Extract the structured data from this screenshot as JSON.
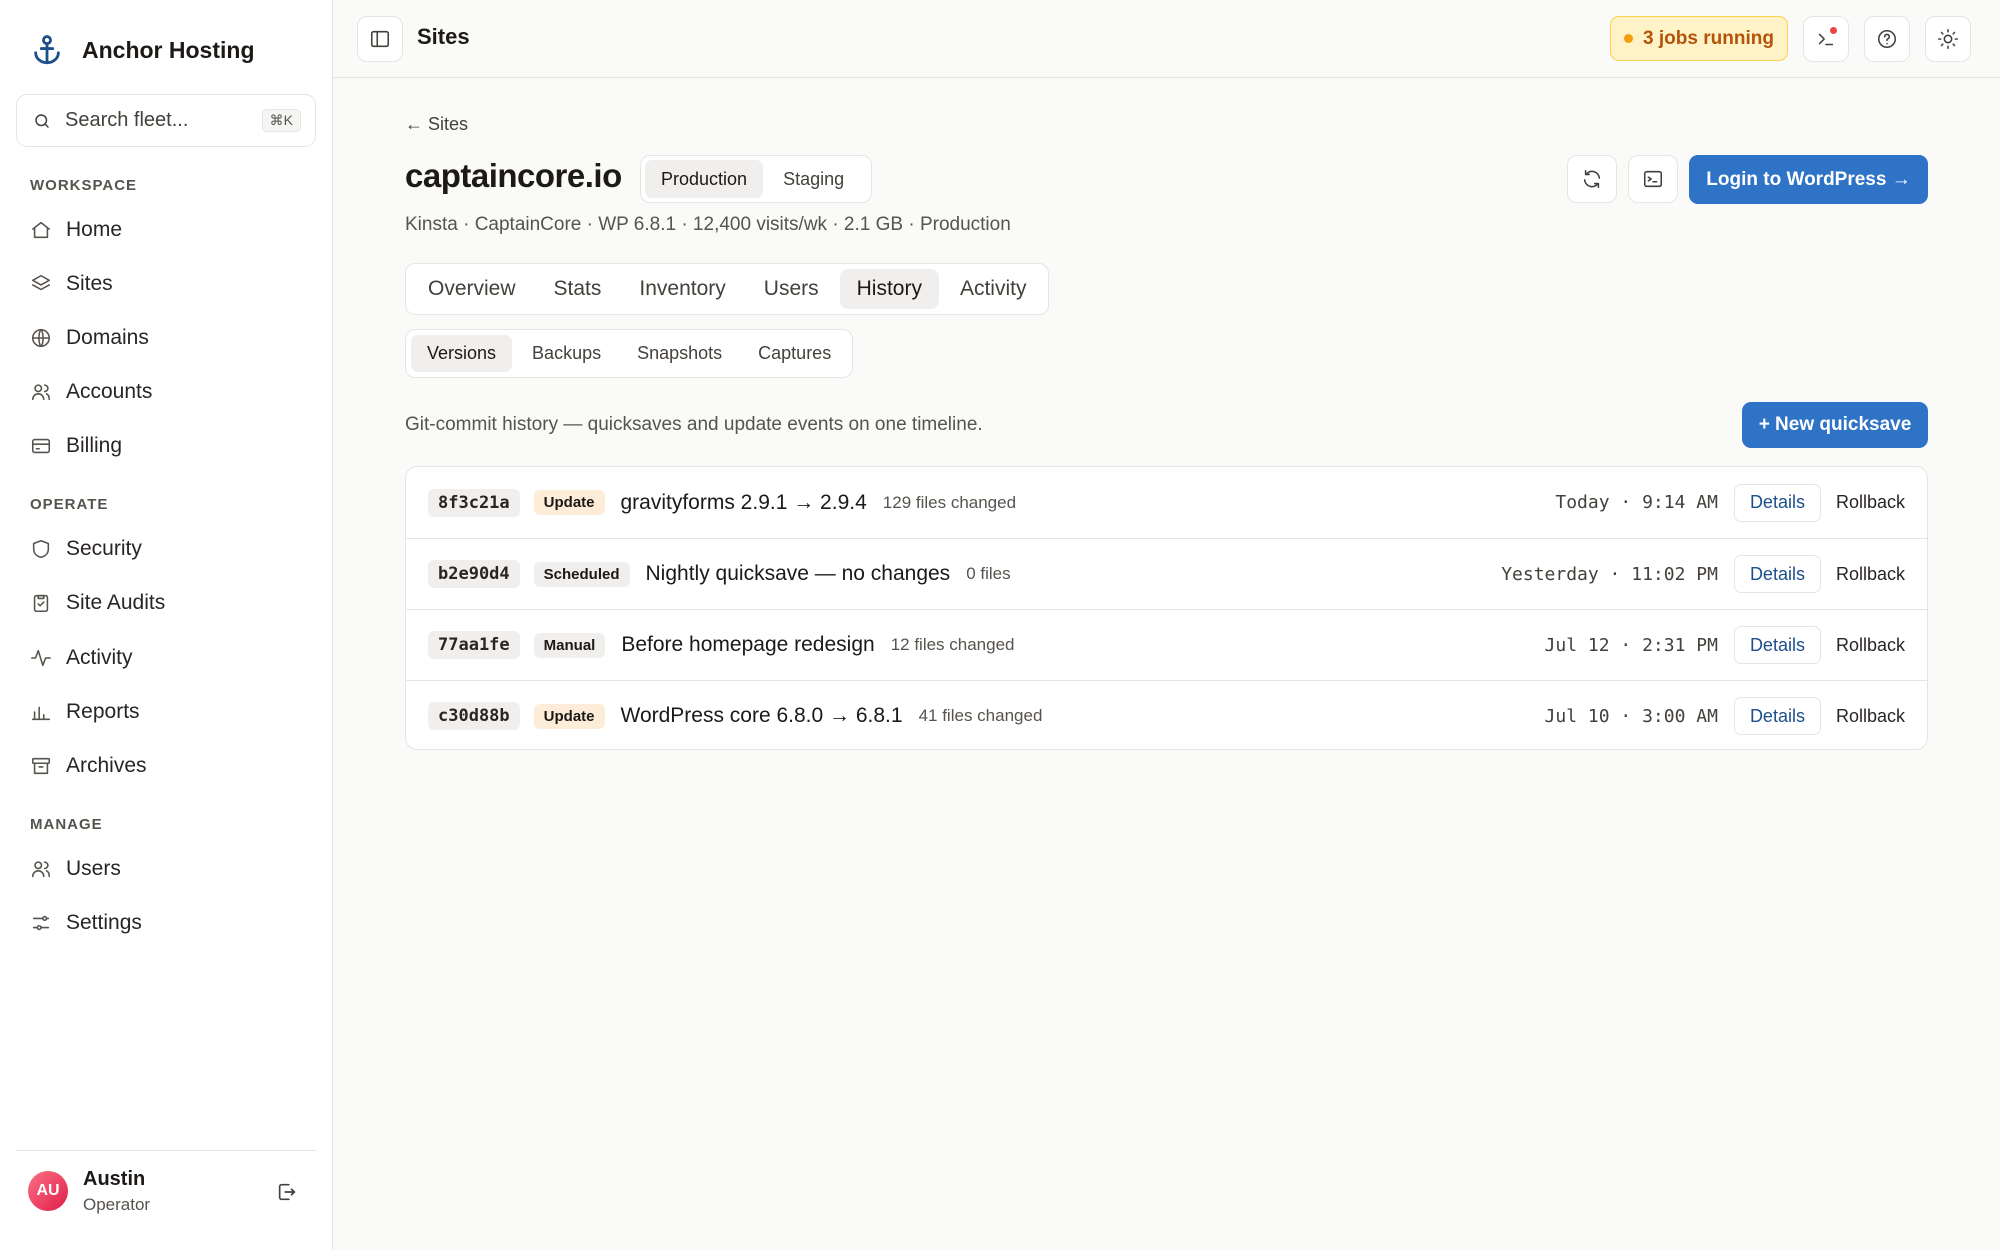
{
  "brand": {
    "name": "Anchor Hosting"
  },
  "search": {
    "placeholder": "Search fleet...",
    "shortcut": "⌘K"
  },
  "sidebar": {
    "sections": [
      {
        "label": "WORKSPACE",
        "items": [
          {
            "label": "Home",
            "icon": "home-icon"
          },
          {
            "label": "Sites",
            "icon": "layers-icon"
          },
          {
            "label": "Domains",
            "icon": "globe-icon"
          },
          {
            "label": "Accounts",
            "icon": "users-icon"
          },
          {
            "label": "Billing",
            "icon": "credit-card-icon"
          }
        ]
      },
      {
        "label": "OPERATE",
        "items": [
          {
            "label": "Security",
            "icon": "shield-icon"
          },
          {
            "label": "Site Audits",
            "icon": "clipboard-icon"
          },
          {
            "label": "Activity",
            "icon": "pulse-icon"
          },
          {
            "label": "Reports",
            "icon": "bar-chart-icon"
          },
          {
            "label": "Archives",
            "icon": "archive-icon"
          }
        ]
      },
      {
        "label": "MANAGE",
        "items": [
          {
            "label": "Users",
            "icon": "users-icon"
          },
          {
            "label": "Settings",
            "icon": "sliders-icon"
          }
        ]
      }
    ]
  },
  "user": {
    "initials": "AU",
    "name": "Austin",
    "role": "Operator"
  },
  "topbar": {
    "title": "Sites",
    "jobs_label": "3 jobs running"
  },
  "site": {
    "back_label": "← Sites",
    "name": "captaincore.io",
    "environments": [
      "Production",
      "Staging"
    ],
    "active_environment": "Production",
    "meta": "Kinsta · CaptainCore · WP 6.8.1 · 12,400 visits/wk · 2.1 GB · Production",
    "login_label": "Login to WordPress →"
  },
  "tabs": [
    "Overview",
    "Stats",
    "Inventory",
    "Users",
    "History",
    "Activity"
  ],
  "active_tab": "History",
  "subtabs": [
    "Versions",
    "Backups",
    "Snapshots",
    "Captures"
  ],
  "active_subtab": "Versions",
  "history": {
    "description": "Git-commit history — quicksaves and update events on one timeline.",
    "new_label": "+ New quicksave",
    "details_label": "Details",
    "rollback_label": "Rollback",
    "rows": [
      {
        "hash": "8f3c21a",
        "badge": "Update",
        "title": "gravityforms 2.9.1 → 2.9.4",
        "files": "129 files changed",
        "time": "Today · 9:14 AM"
      },
      {
        "hash": "b2e90d4",
        "badge": "Scheduled",
        "title": "Nightly quicksave — no changes",
        "files": "0 files",
        "time": "Yesterday · 11:02 PM"
      },
      {
        "hash": "77aa1fe",
        "badge": "Manual",
        "title": "Before homepage redesign",
        "files": "12 files changed",
        "time": "Jul 12 · 2:31 PM"
      },
      {
        "hash": "c30d88b",
        "badge": "Update",
        "title": "WordPress core 6.8.0 → 6.8.1",
        "files": "41 files changed",
        "time": "Jul 10 · 3:00 AM"
      }
    ]
  },
  "colors": {
    "primary": "#2f73c6",
    "jobs_bg": "#fef3c7",
    "jobs_text": "#b45309",
    "update_badge": "#fdecd8"
  }
}
